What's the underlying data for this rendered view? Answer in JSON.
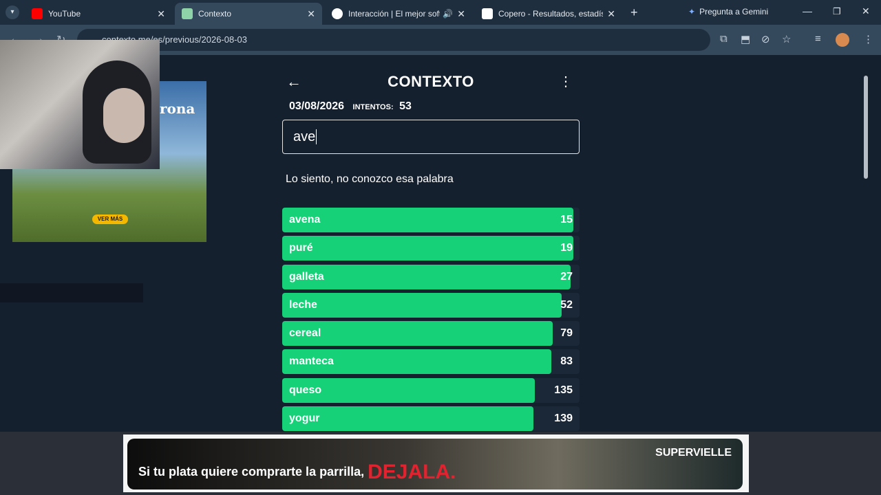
{
  "browser": {
    "tabs": [
      {
        "title": "YouTube",
        "active": false,
        "icon": "youtube-icon"
      },
      {
        "title": "Contexto",
        "active": true,
        "icon": "contexto-icon"
      },
      {
        "title": "Interacción | El mejor softw",
        "active": false,
        "icon": "interaccion-icon"
      },
      {
        "title": "Copero - Resultados, estadístic",
        "active": false,
        "icon": "copero-icon"
      }
    ],
    "gemini_label": "Pregunta a Gemini",
    "url": "contexto.me/es/previous/2026-08-03"
  },
  "game": {
    "title": "CONTEXTO",
    "date": "03/08/2026",
    "attempts_label": "INTENTOS:",
    "attempts": "53",
    "input_value": "ave",
    "message": "Lo siento, no conozco esa palabra",
    "guesses": [
      {
        "word": "avena",
        "rank": "15",
        "fill": 0.98
      },
      {
        "word": "puré",
        "rank": "19",
        "fill": 0.98
      },
      {
        "word": "galleta",
        "rank": "27",
        "fill": 0.97
      },
      {
        "word": "leche",
        "rank": "52",
        "fill": 0.94
      },
      {
        "word": "cereal",
        "rank": "79",
        "fill": 0.91
      },
      {
        "word": "manteca",
        "rank": "83",
        "fill": 0.905
      },
      {
        "word": "queso",
        "rank": "135",
        "fill": 0.85
      },
      {
        "word": "yogur",
        "rank": "139",
        "fill": 0.845
      }
    ]
  },
  "ads": {
    "left_brand": "rona",
    "left_button": "VER MÁS",
    "banner_text": "Si tu plata quiere comprarte la parrilla,",
    "banner_highlight": "DEJALA.",
    "banner_brand": "SUPERVIELLE"
  }
}
